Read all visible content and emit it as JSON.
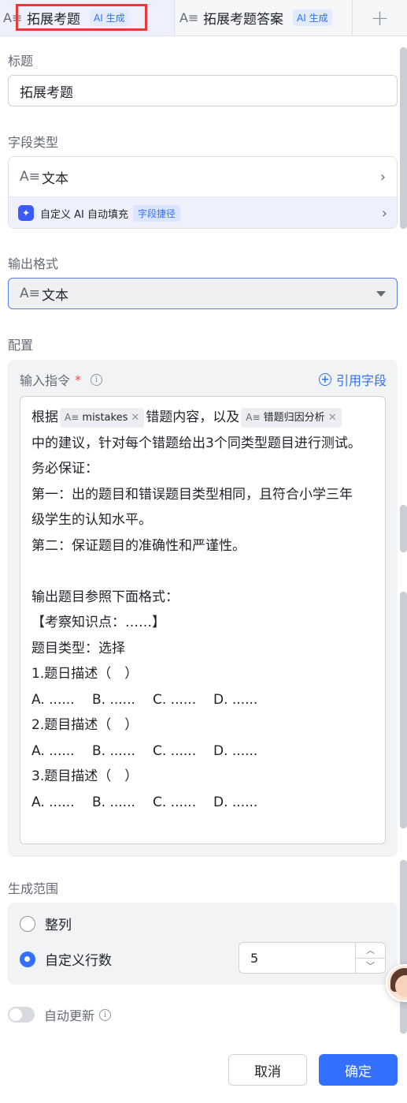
{
  "tabs": [
    {
      "icon": "text-field-icon",
      "label": "拓展考题",
      "badge": "AI 生成",
      "active": true
    },
    {
      "icon": "text-field-icon",
      "label": "拓展考题答案",
      "badge": "AI 生成",
      "active": false
    }
  ],
  "add_tab_label": "+",
  "title_section": {
    "label": "标题",
    "value": "拓展考题"
  },
  "field_type": {
    "label": "字段类型",
    "type_icon": "A≡",
    "type_value": "文本",
    "ai_fill_label": "自定义 AI 自动填充",
    "ai_fill_badge": "字段捷径"
  },
  "output_format": {
    "label": "输出格式",
    "icon": "A≡",
    "value": "文本"
  },
  "config": {
    "label": "配置",
    "instruction_label": "输入指令",
    "required_mark": "*",
    "cite_button": "引用字段",
    "prompt": {
      "line1_pre": "根据",
      "chip1": "mistakes",
      "line1_mid": "错题内容，以及",
      "chip2": "错题归因分析",
      "lines": [
        "中的建议，针对每个错题给出3个同类型题目进行测试。",
        "务必保证：",
        "第一：出的题目和错误题目类型相同，且符合小学三年",
        "级学生的认知水平。",
        "第二：保证题目的准确性和严谨性。",
        "",
        "输出题目参照下面格式：",
        "【考察知识点：……】",
        "题目类型：选择",
        "1.题日描述（　）"
      ],
      "options": [
        "A. ......",
        "B. ......",
        "C. ......",
        "D. ......"
      ],
      "q2": "2.题目描述（　）",
      "q3": "3.题目描述（　）"
    }
  },
  "scope": {
    "label": "生成范围",
    "option_all": "整列",
    "option_custom": "自定义行数",
    "selected": "custom",
    "rows_value": "5"
  },
  "auto_update": {
    "label": "自动更新",
    "enabled": false
  },
  "buttons": {
    "cancel": "取消",
    "confirm": "确定"
  },
  "colors": {
    "accent": "#3370ff",
    "highlight": "#e83a3a",
    "required": "#f54a45"
  }
}
